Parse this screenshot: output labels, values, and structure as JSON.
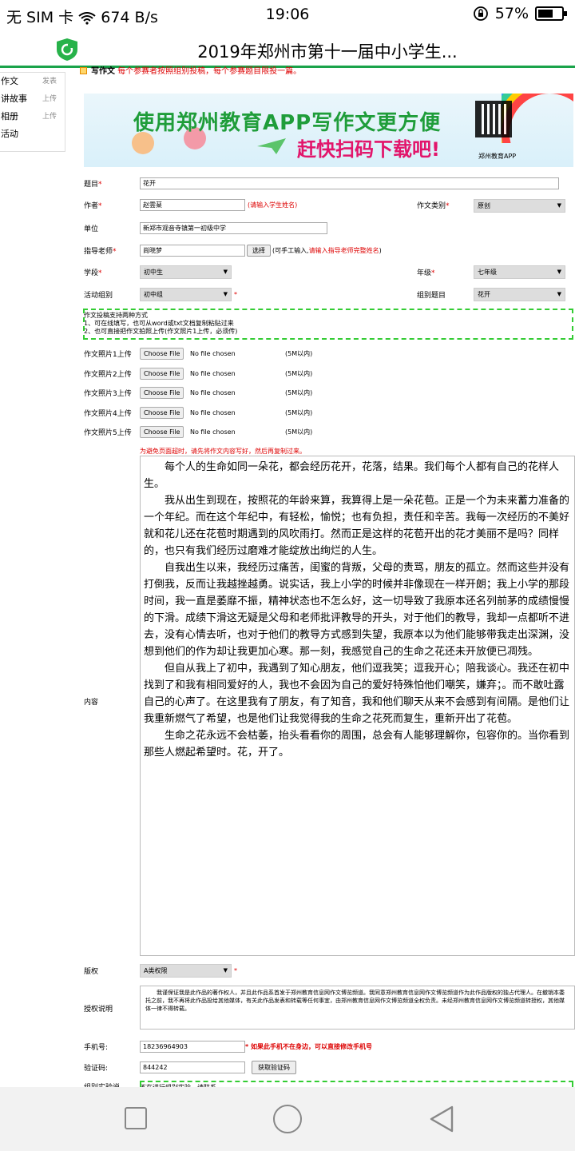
{
  "status": {
    "left": "无 SIM 卡",
    "speed": "674 B/s",
    "time": "19:06",
    "battery": "57%"
  },
  "title": "2019年郑州市第十一届中小学生...",
  "leftnav": [
    {
      "label": "作文",
      "action": "发表"
    },
    {
      "label": "讲故事",
      "action": "上传"
    },
    {
      "label": "相册",
      "action": "上传"
    },
    {
      "label": "活动",
      "action": ""
    }
  ],
  "section": {
    "heading": "写作文",
    "note": "每个参赛者按照组别投稿，每个参赛题目限投一篇。"
  },
  "banner": {
    "line1": "使用郑州教育APP写作文更方便",
    "line2": "赶快扫码下载吧!",
    "qr_label": "郑州教育APP"
  },
  "form": {
    "title_label": "题目",
    "title_value": "花开",
    "author_label": "作者",
    "author_value": "赵雲棻",
    "author_hint": "(请输入学生姓名)",
    "category_label": "作文类别",
    "category_value": "原创",
    "unit_label": "单位",
    "unit_value": "新郑市观音寺镇第一初级中学",
    "teacher_label": "指导老师",
    "teacher_value": "尚晓梦",
    "select_btn": "选择",
    "teacher_hint_a": "(可手工输入,",
    "teacher_hint_b": "请输入指导老师完整姓名",
    "teacher_hint_c": ")",
    "stage_label": "学段",
    "stage_value": "初中生",
    "grade_label": "年级",
    "grade_value": "七年级",
    "group_label": "活动组别",
    "group_value": "初中组",
    "topic_label": "组别题目",
    "topic_value": "花开",
    "tips": [
      "作文投稿支持两种方式",
      "1、可在线填写，也可从word或txt文档复制粘贴过来",
      "2、也可直接把作文拍照上传(作文照片1上传，必须传)"
    ],
    "photos": [
      {
        "label": "作文照片1上传",
        "btn": "Choose File",
        "status": "No file chosen",
        "limit": "(5M以内)"
      },
      {
        "label": "作文照片2上传",
        "btn": "Choose File",
        "status": "No file chosen",
        "limit": "(5M以内)"
      },
      {
        "label": "作文照片3上传",
        "btn": "Choose File",
        "status": "No file chosen",
        "limit": "(5M以内)"
      },
      {
        "label": "作文照片4上传",
        "btn": "Choose File",
        "status": "No file chosen",
        "limit": "(5M以内)"
      },
      {
        "label": "作文照片5上传",
        "btn": "Choose File",
        "status": "No file chosen",
        "limit": "(5M以内)"
      }
    ],
    "timeout_warning": "为避免页面超时，请先将作文内容写好，然后再复制过来。",
    "content_label": "内容",
    "content": [
      "每个人的生命如同一朵花，都会经历花开，花落，结果。我们每个人都有自己的花样人生。",
      "我从出生到现在，按照花的年龄来算，我算得上是一朵花苞。正是一个为未来蓄力准备的一个年纪。而在这个年纪中，有轻松，愉悦；也有负担，责任和辛苦。我每一次经历的不美好就和花儿还在花苞时期遇到的风吹雨打。然而正是这样的花苞开出的花才美丽不是吗？同样的，也只有我们经历过磨难才能绽放出绚烂的人生。",
      "自我出生以来，我经历过痛苦，闺蜜的背叛，父母的责骂，朋友的孤立。然而这些并没有打倒我，反而让我越挫越勇。说实话，我上小学的时候并非像现在一样开朗；我上小学的那段时间，我一直是萎靡不振，精神状态也不怎么好，这一切导致了我原本还名列前茅的成绩慢慢的下滑。成绩下滑这无疑是父母和老师批评教导的开头，对于他们的教导，我却一点都听不进去，没有心情去听，也对于他们的教导方式感到失望，我原本以为他们能够带我走出深渊，没想到他们的作为却让我更加心寒。那一刻，我感觉自己的生命之花还未开放便已凋残。",
      "但自从我上了初中，我遇到了知心朋友，他们逗我笑；逗我开心；陪我谈心。我还在初中找到了和我有相同爱好的人，我也不会因为自己的爱好特殊怕他们嘲笑，嫌弃；。而不敢吐露自己的心声了。在这里我有了朋友，有了知音，我和他们聊天从来不会感到有间隔。是他们让我重新燃气了希望，也是他们让我觉得我的生命之花死而复生，重新开出了花苞。",
      "生命之花永远不会枯萎，抬头看看你的周围，总会有人能够理解你，包容你的。当你看到那些人燃起希望时。花，开了。"
    ],
    "copyright_label": "版权",
    "copyright_value": "A类权限",
    "auth_label": "授权说明",
    "auth_text": "我谨保证我是此作品的著作权人，并且此作品系首发于郑州教育信息网作文博览频道。我同意郑州教育信息网作文博览频道作为此作品版权的独占代理人。在撤销本委托之前，我不再将此作品投给其他媒体，有关此作品发表和转载等任何事宜，由郑州教育信息网作文博览频道全权负责。未经郑州教育信息网作文博览频道转授权，其他媒体一律不得转载。",
    "phone_label": "手机号:",
    "phone_value": "18236964903",
    "phone_hint": "* 如果此手机不在身边，可以直接修改手机号",
    "code_label": "验证码:",
    "code_value": "844242",
    "code_btn": "获取验证码",
    "cut_label": "组别实验说",
    "cut_text": "不在进行组别实验，请联系"
  }
}
